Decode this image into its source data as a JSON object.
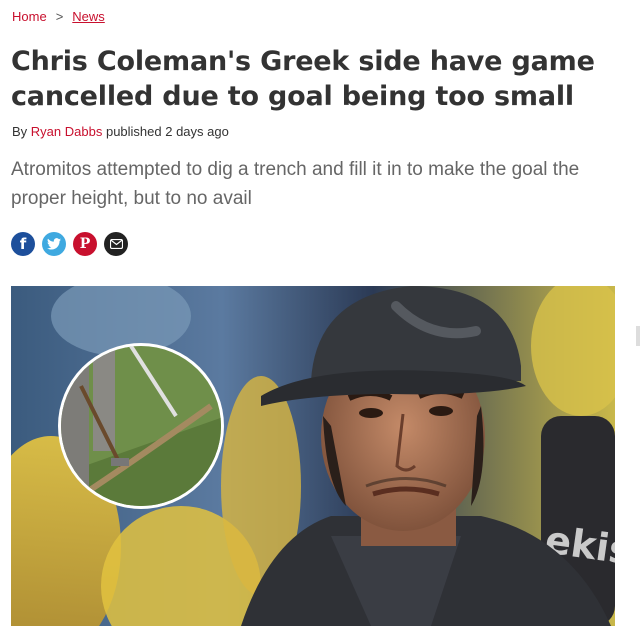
{
  "breadcrumb": {
    "home": "Home",
    "separator": ">",
    "current": "News"
  },
  "article": {
    "title": "Chris Coleman's Greek side have game cancelled due to goal being too small",
    "byline_prefix": "By",
    "author": "Ryan Dabbs",
    "published": "published 2 days ago",
    "standfirst": "Atromitos attempted to dig a trench and fill it in to make the goal the proper height, but to no avail"
  },
  "share": {
    "icons": [
      "facebook-icon",
      "twitter-icon",
      "pinterest-icon",
      "email-icon"
    ],
    "facebook_glyph": "f",
    "pinterest_glyph": "P"
  },
  "hero": {
    "inset_description_icon": "groundsman-inset-image",
    "jersey_text": "ekis"
  },
  "colors": {
    "accent": "#c8102e",
    "facebook": "#1d4f9b",
    "twitter": "#3fa9e0",
    "email": "#222222"
  }
}
